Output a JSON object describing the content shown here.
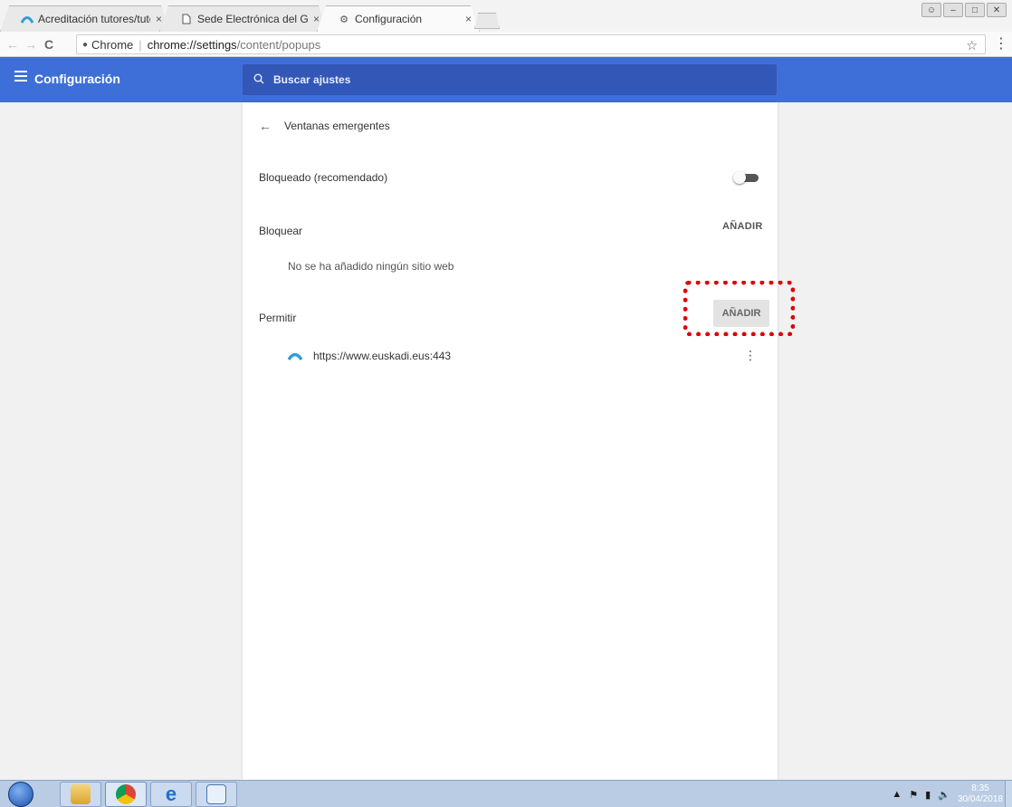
{
  "browser": {
    "tabs": [
      {
        "label": "Acreditación tutores/tuto",
        "icon": "euskadi-logo-icon"
      },
      {
        "label": "Sede Electrónica del Gob",
        "icon": "page-icon"
      },
      {
        "label": "Configuración",
        "icon": "gear-icon"
      }
    ],
    "close_glyph": "×",
    "address": {
      "chrome_label": "Chrome",
      "separator": "|",
      "host": "chrome://settings",
      "path": "/content/popups"
    }
  },
  "settings": {
    "title": "Configuración",
    "search_placeholder": "Buscar ajustes",
    "page_title": "Ventanas emergentes",
    "blocked_label": "Bloqueado (recomendado)",
    "blocked_enabled": false,
    "block_section": {
      "label": "Bloquear",
      "add_label": "AÑADIR",
      "empty_message": "No se ha añadido ningún sitio web"
    },
    "allow_section": {
      "label": "Permitir",
      "add_label": "AÑADIR",
      "sites": [
        "https://www.euskadi.eus:443"
      ]
    }
  },
  "taskbar": {
    "time": "8:35",
    "date": "30/04/2018"
  },
  "colors": {
    "accent": "#3e6fd9",
    "highlight": "#e00000"
  }
}
